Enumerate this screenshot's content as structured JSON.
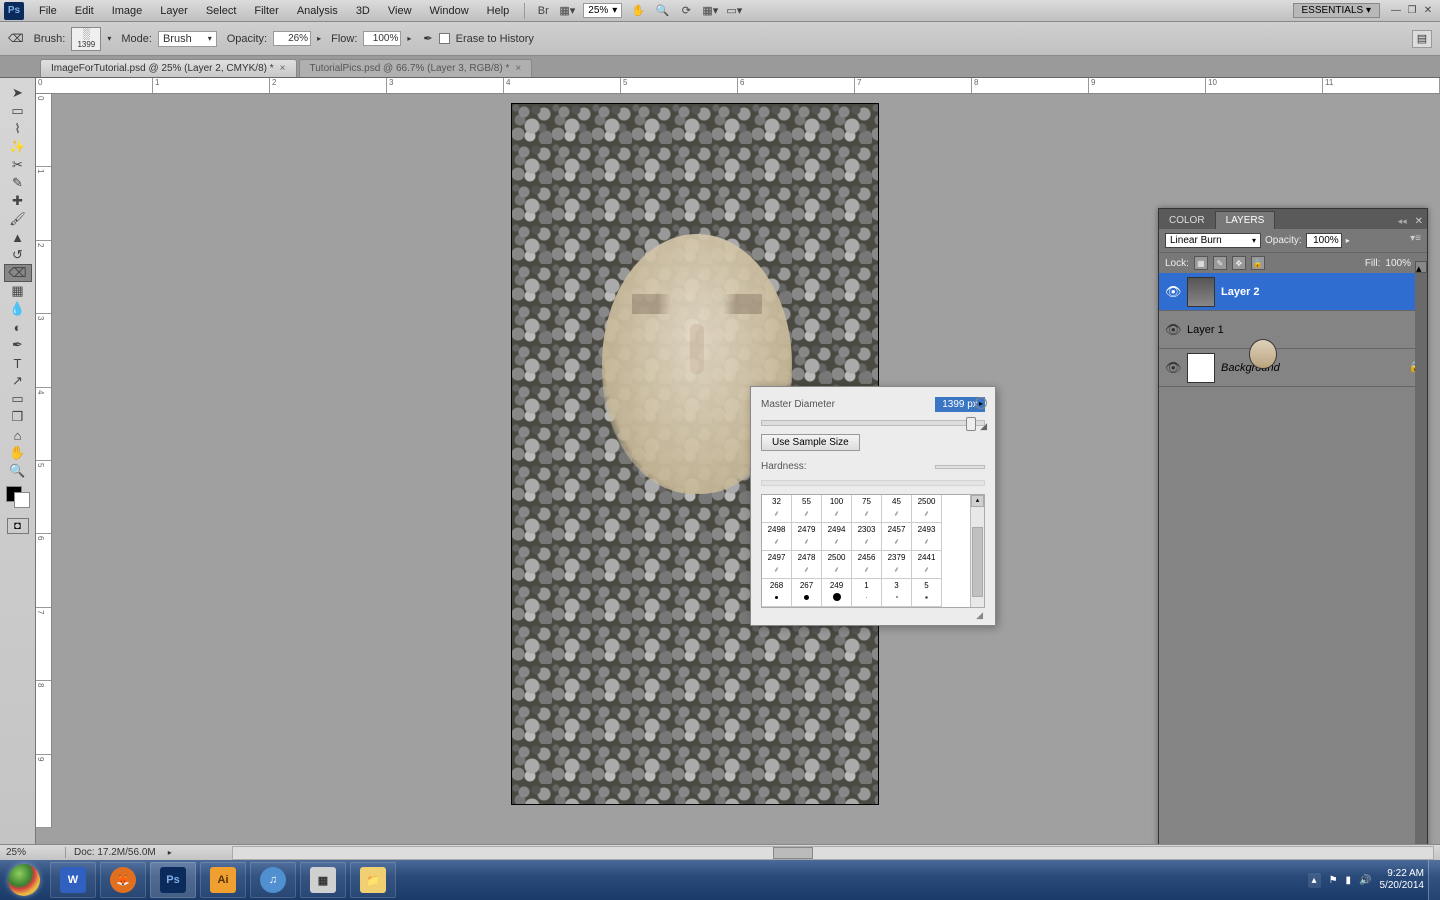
{
  "menu": {
    "items": [
      "File",
      "Edit",
      "Image",
      "Layer",
      "Select",
      "Filter",
      "Analysis",
      "3D",
      "View",
      "Window",
      "Help"
    ],
    "zoom": "25%"
  },
  "workspace": {
    "label": "ESSENTIALS ▾"
  },
  "optbar": {
    "brush_label": "Brush:",
    "brush_size": "1399",
    "mode_label": "Mode:",
    "mode_value": "Brush",
    "opacity_label": "Opacity:",
    "opacity_value": "26%",
    "flow_label": "Flow:",
    "flow_value": "100%",
    "erase_label": "Erase to History"
  },
  "tabs": [
    {
      "label": "ImageForTutorial.psd @ 25% (Layer 2, CMYK/8) *",
      "active": true
    },
    {
      "label": "TutorialPics.psd @ 66.7% (Layer 3, RGB/8) *",
      "active": false
    }
  ],
  "brush_popup": {
    "master_label": "Master Diameter",
    "master_value": "1399 px",
    "use_sample": "Use Sample Size",
    "hardness_label": "Hardness:",
    "presets": [
      32,
      55,
      100,
      75,
      45,
      2500,
      2498,
      2479,
      2494,
      2303,
      2457,
      2493,
      2497,
      2478,
      2500,
      2456,
      2379,
      2441,
      268,
      267,
      249,
      1,
      3,
      5
    ]
  },
  "layers": {
    "tab_color": "COLOR",
    "tab_layers": "LAYERS",
    "blend": "Linear Burn",
    "opacity_label": "Opacity:",
    "opacity_value": "100%",
    "lock_label": "Lock:",
    "fill_label": "Fill:",
    "fill_value": "100%",
    "items": [
      {
        "name": "Layer 2",
        "sel": true
      },
      {
        "name": "Layer 1",
        "sel": false
      },
      {
        "name": "Background",
        "sel": false,
        "locked": true,
        "italic": true
      }
    ]
  },
  "status": {
    "zoom": "25%",
    "doc": "Doc: 17.2M/56.0M"
  },
  "taskbar": {
    "time": "9:22 AM",
    "date": "5/20/2014"
  },
  "ruler_h": [
    "0",
    "1",
    "2",
    "3",
    "4",
    "5",
    "6",
    "7",
    "8",
    "9",
    "10",
    "11"
  ],
  "ruler_v": [
    "0",
    "1",
    "2",
    "3",
    "4",
    "5",
    "6",
    "7",
    "8",
    "9"
  ]
}
